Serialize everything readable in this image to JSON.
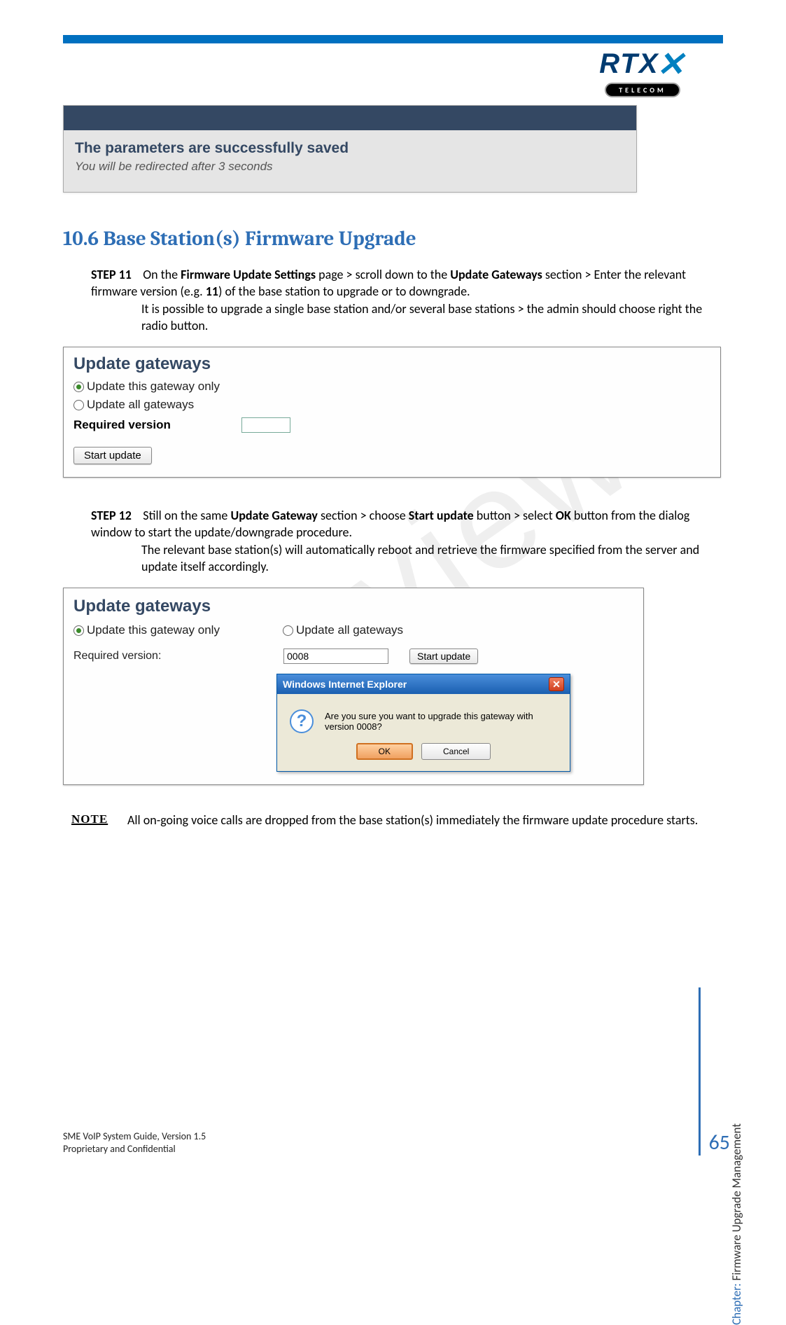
{
  "logo": {
    "brand": "RTX",
    "sub": "TELECOM"
  },
  "message": {
    "title": "The parameters are successfully saved",
    "sub": "You will be redirected after 3 seconds"
  },
  "section": {
    "title": "10.6 Base Station(s) Firmware Upgrade"
  },
  "step11": {
    "label": "STEP 11",
    "text1a": "On the ",
    "bold1": "Firmware Update Settings",
    "text1b": " page > scroll down to the ",
    "bold2": "Update Gateways",
    "text1c": " section > Enter the relevant firmware version (e.g. ",
    "bold3": "11",
    "text1d": ") of the base station to upgrade or to downgrade.",
    "text2": "It is possible to upgrade a single base station and/or several base stations > the admin should choose right the radio button."
  },
  "ui1": {
    "title": "Update gateways",
    "radio1": "Update this gateway only",
    "radio2": "Update all gateways",
    "field_label": "Required version",
    "button": "Start update"
  },
  "step12": {
    "label": "STEP 12",
    "text1a": "Still on the same ",
    "bold1": "Update Gateway",
    "text1b": " section > choose ",
    "bold2": "Start update",
    "text1c": " button > select ",
    "bold3": "OK",
    "text1d": " button from the dialog window to start the update/downgrade procedure.",
    "text2": "The relevant base station(s) will automatically reboot and retrieve the firmware specified from the server and update itself accordingly."
  },
  "ui2": {
    "title": "Update gateways",
    "radio1": "Update this gateway only",
    "radio2": "Update all gateways",
    "field_label": "Required version:",
    "input_value": "0008",
    "button": "Start update",
    "dialog": {
      "title": "Windows Internet Explorer",
      "text": "Are you sure you want to upgrade this gateway with version 0008?",
      "ok": "OK",
      "cancel": "Cancel"
    }
  },
  "note": {
    "label": "NOTE",
    "text": "All on-going voice calls are dropped from the base station(s) immediately the firmware update procedure starts."
  },
  "side": {
    "prefix": "Chapter: ",
    "text": "Firmware Upgrade Management"
  },
  "footer": {
    "line1": "SME VoIP System Guide, Version 1.5",
    "line2": "Proprietary and Confidential",
    "page": "65"
  },
  "watermark": "Preview"
}
